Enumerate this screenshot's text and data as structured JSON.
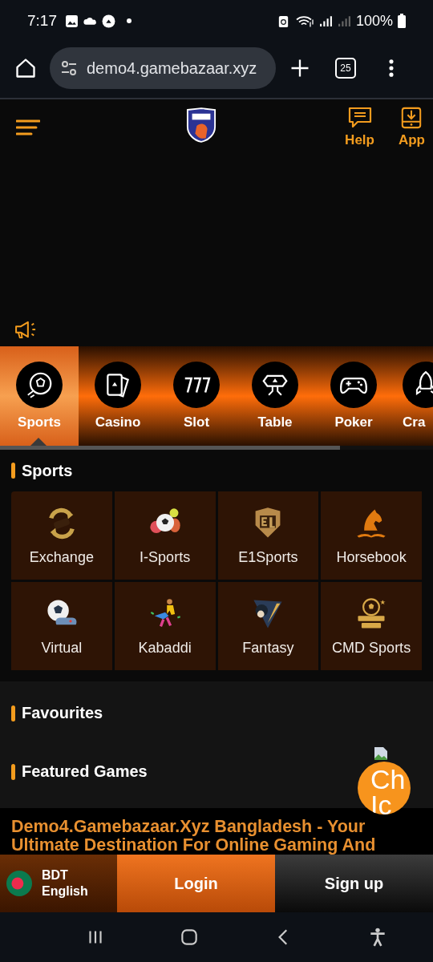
{
  "status_bar": {
    "time": "7:17",
    "battery": "100%"
  },
  "browser": {
    "url": "demo4.gamebazaar.xyz",
    "tab_count": "25"
  },
  "header": {
    "actions": [
      "Help",
      "App"
    ]
  },
  "categories": [
    {
      "label": "Sports",
      "selected": true
    },
    {
      "label": "Casino",
      "selected": false
    },
    {
      "label": "Slot",
      "selected": false
    },
    {
      "label": "Table",
      "selected": false
    },
    {
      "label": "Poker",
      "selected": false
    },
    {
      "label": "Cra",
      "selected": false
    }
  ],
  "sports_section": {
    "title": "Sports",
    "items": [
      "Exchange",
      "I-Sports",
      "E1Sports",
      "Horsebook",
      "Virtual",
      "Kabaddi",
      "Fantasy",
      "CMD Sports"
    ]
  },
  "favourites_title": "Favourites",
  "featured_title": "Featured Games",
  "chat_button": {
    "lines": [
      "Ch",
      "Ic"
    ]
  },
  "seo_heading": "Demo4.Gamebazaar.Xyz Bangladesh - Your Ultimate Destination For Online Gaming And",
  "bottom_bar": {
    "currency": "BDT",
    "language": "English",
    "login": "Login",
    "signup": "Sign up"
  }
}
